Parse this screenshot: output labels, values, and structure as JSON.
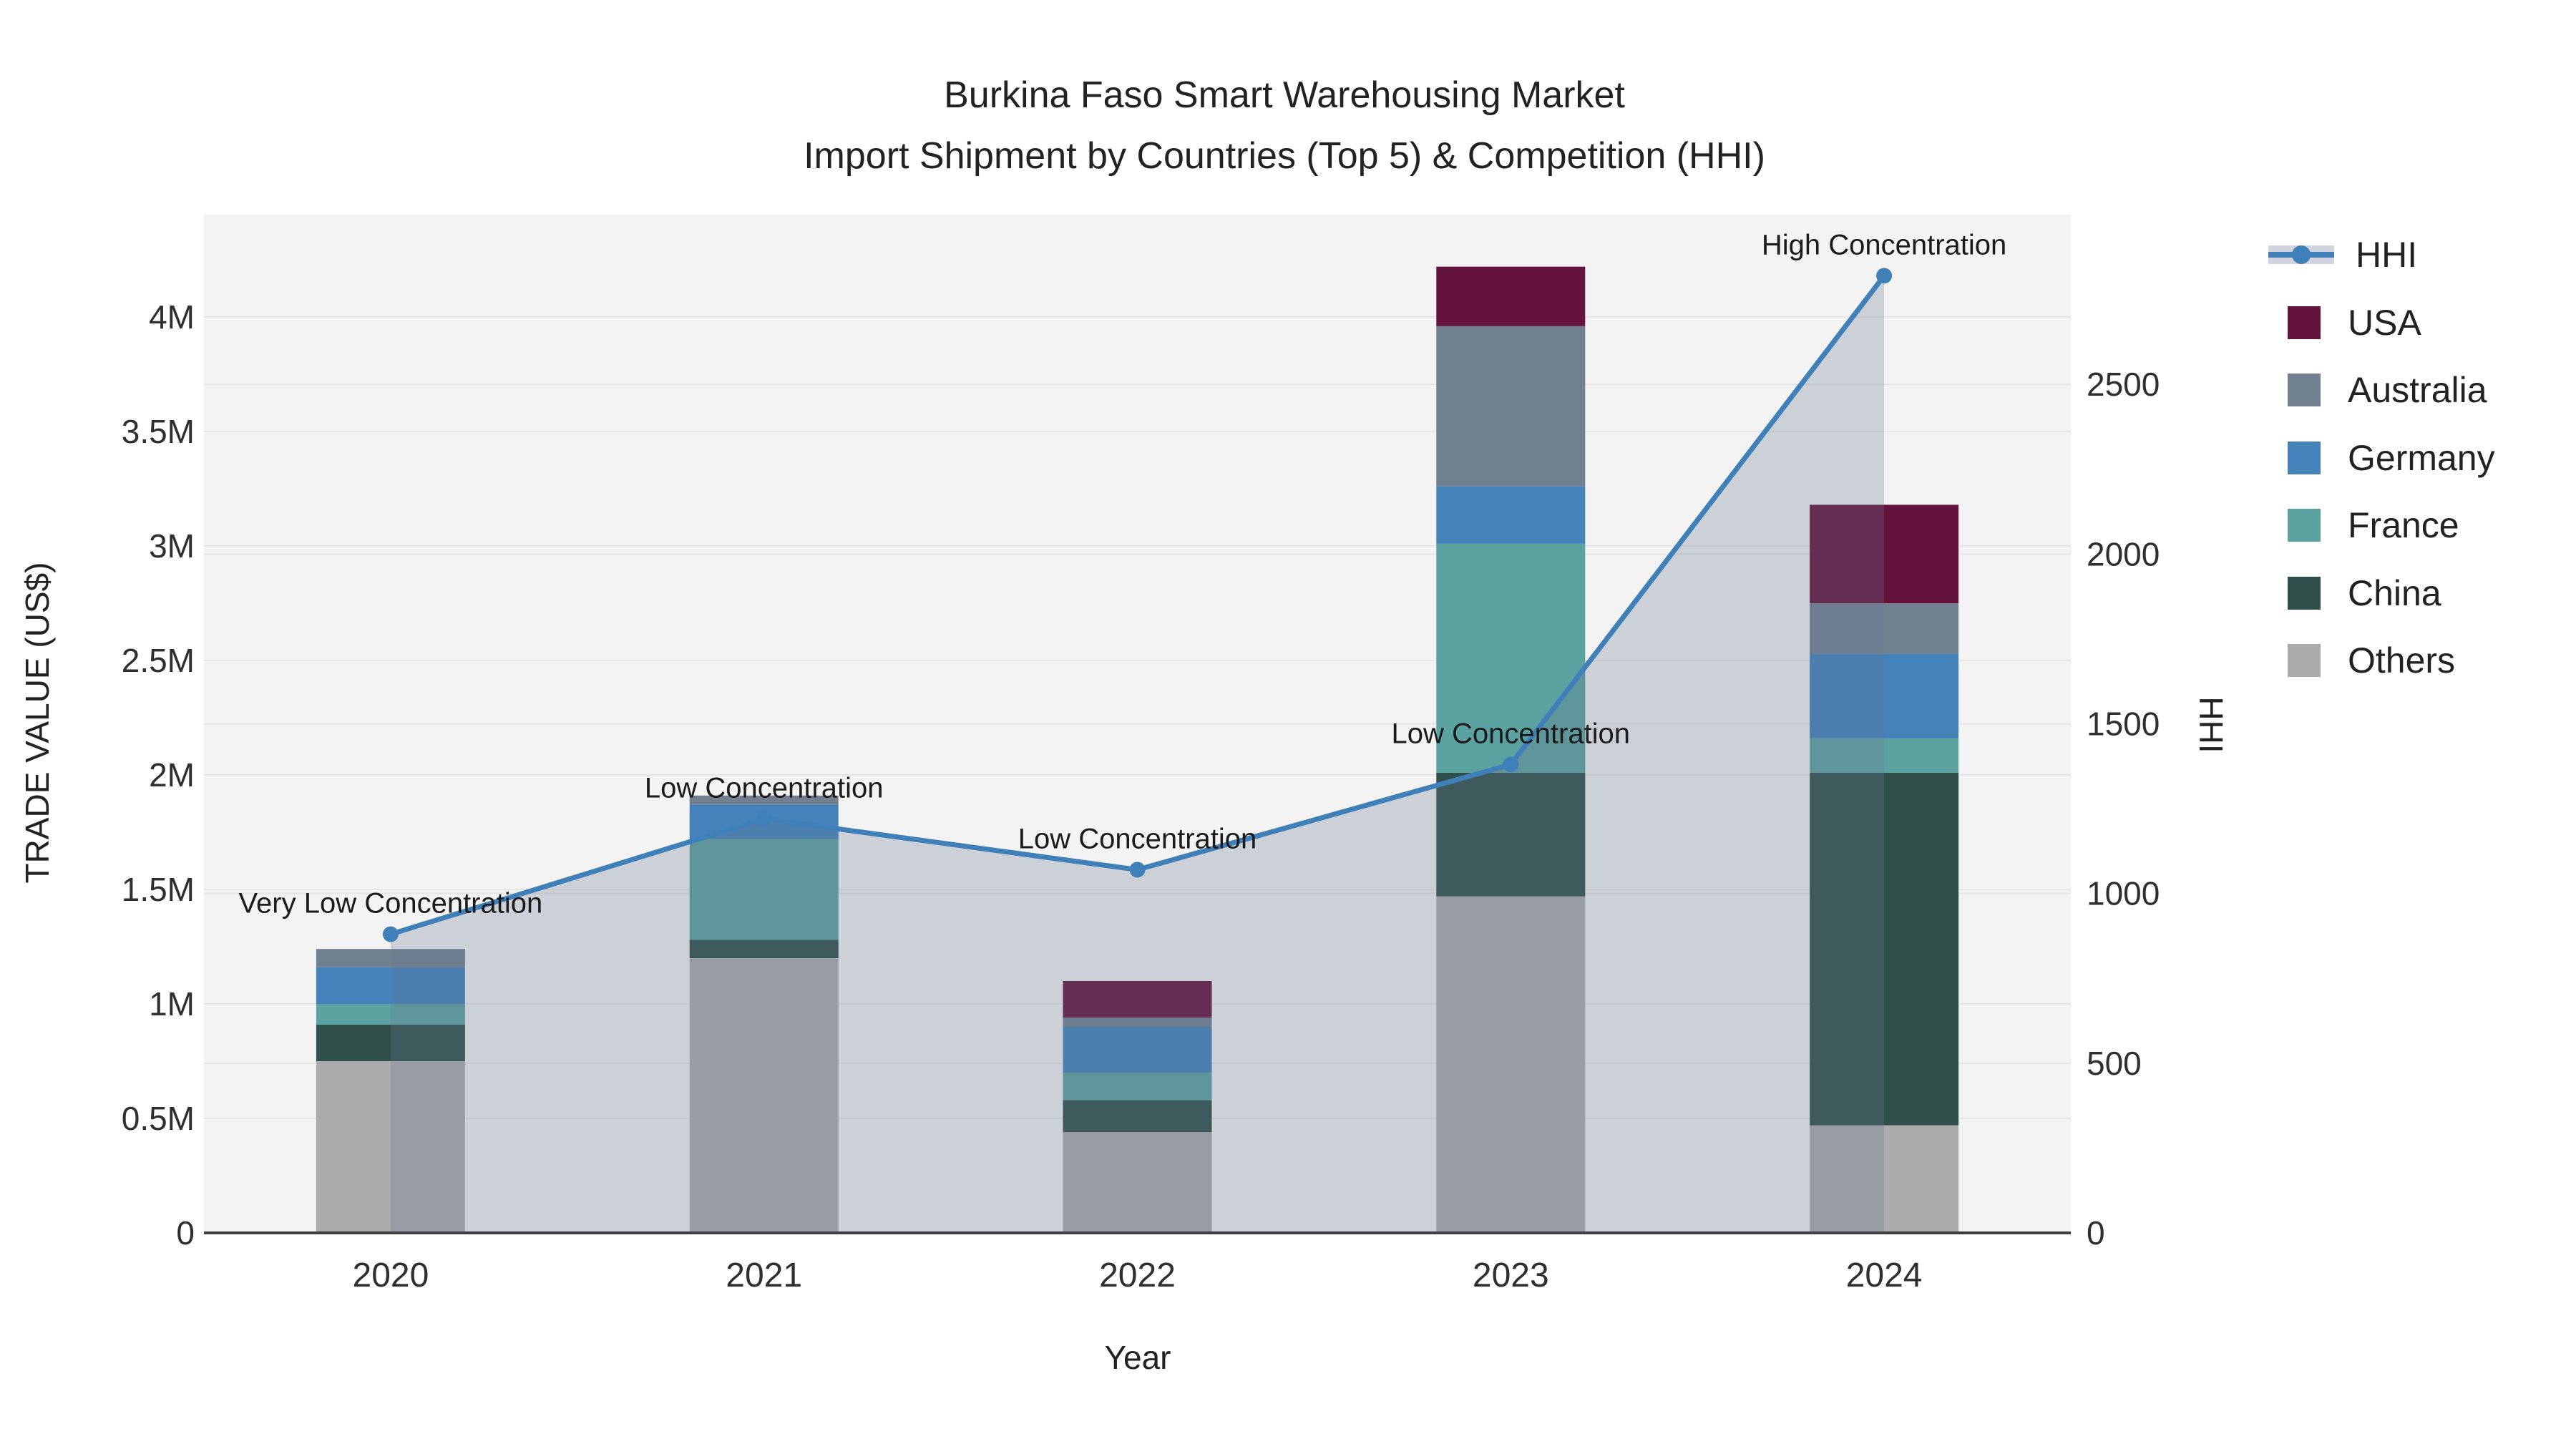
{
  "title": {
    "line1": "Burkina Faso Smart Warehousing Market",
    "line2": "Import Shipment by Countries (Top 5) & Competition (HHI)"
  },
  "chart_data": {
    "type": "bar+line combo (stacked bars, secondary-axis line with area fill)",
    "categories": [
      "2020",
      "2021",
      "2022",
      "2023",
      "2024"
    ],
    "xlabel": "Year",
    "ylabel_left": "TRADE VALUE (US$)",
    "ylabel_right": "HHI",
    "left_axis": {
      "max": 4.447,
      "units": "million US$",
      "ticks": [
        {
          "v": 0,
          "label": "0"
        },
        {
          "v": 0.5,
          "label": "0.5M"
        },
        {
          "v": 1,
          "label": "1M"
        },
        {
          "v": 1.5,
          "label": "1.5M"
        },
        {
          "v": 2,
          "label": "2M"
        },
        {
          "v": 2.5,
          "label": "2.5M"
        },
        {
          "v": 3,
          "label": "3M"
        },
        {
          "v": 3.5,
          "label": "3.5M"
        },
        {
          "v": 4,
          "label": "4M"
        }
      ]
    },
    "right_axis": {
      "max": 3000,
      "ticks": [
        {
          "v": 0,
          "label": "0"
        },
        {
          "v": 500,
          "label": "500"
        },
        {
          "v": 1000,
          "label": "1000"
        },
        {
          "v": 1500,
          "label": "1500"
        },
        {
          "v": 2000,
          "label": "2000"
        },
        {
          "v": 2500,
          "label": "2500"
        }
      ]
    },
    "series": [
      {
        "name": "Others",
        "color": "#ABABAB",
        "values": [
          0.75,
          1.2,
          0.44,
          1.47,
          0.47
        ]
      },
      {
        "name": "China",
        "color": "#2E4F4A",
        "values": [
          0.16,
          0.08,
          0.14,
          0.54,
          1.54
        ]
      },
      {
        "name": "France",
        "color": "#5AA3A0",
        "values": [
          0.09,
          0.44,
          0.12,
          1.0,
          0.15
        ]
      },
      {
        "name": "Germany",
        "color": "#4383BA",
        "values": [
          0.16,
          0.15,
          0.2,
          0.25,
          0.37
        ]
      },
      {
        "name": "Australia",
        "color": "#71808F",
        "values": [
          0.08,
          0.04,
          0.04,
          0.7,
          0.22
        ]
      },
      {
        "name": "USA",
        "color": "#64143C",
        "values": [
          0.0,
          0.0,
          0.16,
          0.26,
          0.43
        ]
      }
    ],
    "line_series": {
      "name": "HHI",
      "color": "#4080B8",
      "area_fill": "rgba(105,120,145,0.28)",
      "values": [
        880,
        1220,
        1070,
        1380,
        2820
      ]
    },
    "annotations": [
      "Very Low Concentration",
      "Low Concentration",
      "Low Concentration",
      "Low Concentration",
      "High Concentration"
    ],
    "legend_position": "right",
    "grid": "on"
  },
  "legend": {
    "items": [
      {
        "label": "HHI",
        "type": "line",
        "color": "#4080B8",
        "band": "#cfd4de"
      },
      {
        "label": "USA",
        "type": "swatch",
        "color": "#64143C"
      },
      {
        "label": "Australia",
        "type": "swatch",
        "color": "#71808F"
      },
      {
        "label": "Germany",
        "type": "swatch",
        "color": "#4383BA"
      },
      {
        "label": "France",
        "type": "swatch",
        "color": "#5AA3A0"
      },
      {
        "label": "China",
        "type": "swatch",
        "color": "#2E4F4A"
      },
      {
        "label": "Others",
        "type": "swatch",
        "color": "#ABABAB"
      }
    ]
  },
  "colors": {
    "plot_bg": "#f3f3f3",
    "gridline": "#e6e6e6",
    "axis_line": "#3f3f3f",
    "tick_text": "#2f2f2f",
    "annotation_text": "#1b1b1b"
  }
}
